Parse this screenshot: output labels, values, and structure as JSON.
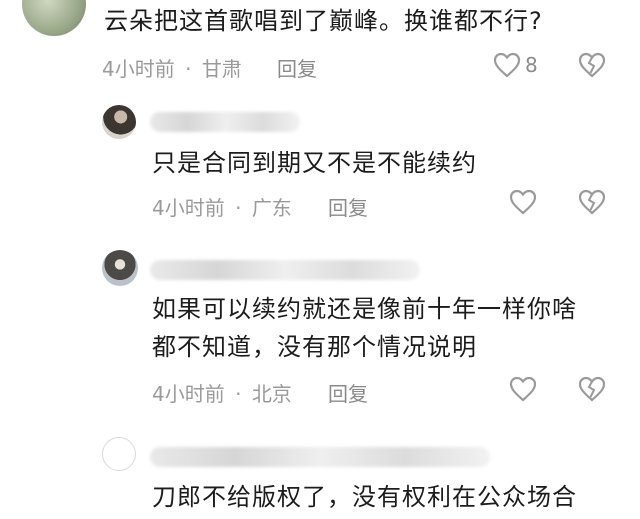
{
  "comments": [
    {
      "text": "云朵把这首歌唱到了巅峰。换谁都不行?",
      "time": "4小时前",
      "location": "甘肃",
      "reply_label": "回复",
      "like_count": "8"
    },
    {
      "text": "只是合同到期又不是不能续约",
      "time": "4小时前",
      "location": "广东",
      "reply_label": "回复"
    },
    {
      "text_line1": "如果可以续约就还是像前十年一样你啥",
      "text_line2": "都不知道，没有那个情况说明",
      "time": "4小时前",
      "location": "北京",
      "reply_label": "回复"
    },
    {
      "text": "刀郎不给版权了，没有权利在公众场合"
    }
  ],
  "separator": "·",
  "icons": [
    "heart-outline-icon",
    "broken-heart-icon"
  ]
}
